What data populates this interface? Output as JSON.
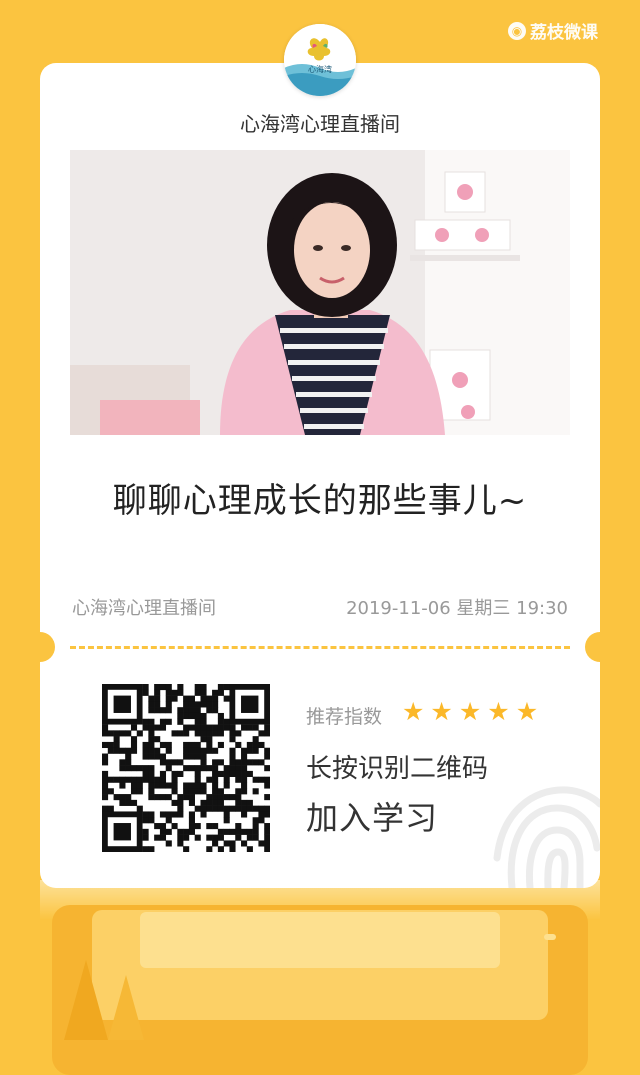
{
  "brand": {
    "name": "荔枝微课",
    "icon": "lizhi-logo-icon"
  },
  "host": {
    "name": "心海湾心理直播间",
    "avatar_text": "心海湾"
  },
  "course": {
    "title": "聊聊心理成长的那些事儿~",
    "host_name": "心海湾心理直播间",
    "datetime": "2019-11-06 星期三 19:30"
  },
  "qr": {
    "recommend_label": "推荐指数",
    "rating": 5,
    "max_rating": 5,
    "hint": "长按识别二维码",
    "action": "加入学习"
  },
  "colors": {
    "accent": "#fbc440",
    "star": "#fbb829"
  }
}
